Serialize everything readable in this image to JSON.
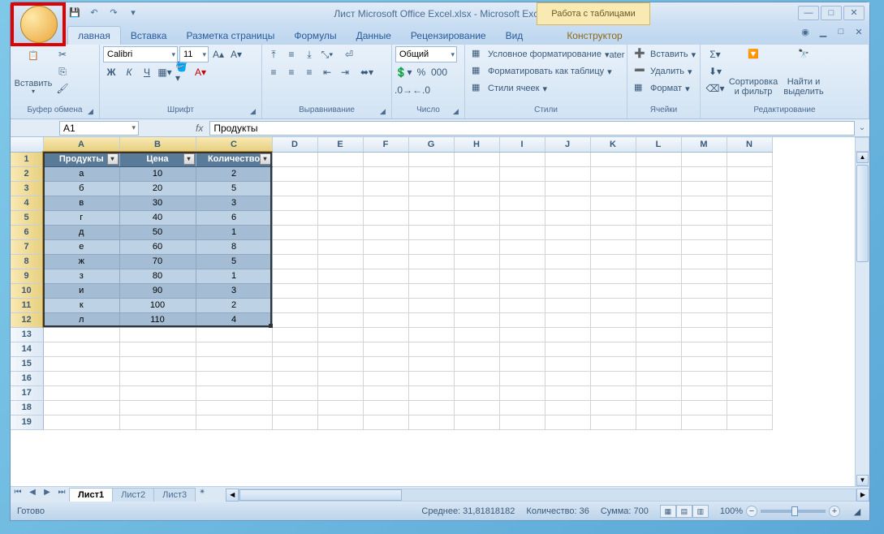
{
  "title": "Лист Microsoft Office Excel.xlsx - Microsoft Excel",
  "contextTab": "Работа с таблицами",
  "tabs": [
    "лавная",
    "Вставка",
    "Разметка страницы",
    "Формулы",
    "Данные",
    "Рецензирование",
    "Вид",
    "Конструктор"
  ],
  "ribbon": {
    "clipboard": {
      "label": "Буфер обмена",
      "paste": "Вставить"
    },
    "font": {
      "label": "Шрифт",
      "name": "Calibri",
      "size": "11"
    },
    "align": {
      "label": "Выравнивание"
    },
    "number": {
      "label": "Число",
      "format": "Общий"
    },
    "styles": {
      "label": "Стили",
      "cond": "Условное форматирование",
      "astable": "Форматировать как таблицу",
      "cellstyles": "Стили ячеек"
    },
    "cells": {
      "label": "Ячейки",
      "insert": "Вставить",
      "delete": "Удалить",
      "format": "Формат"
    },
    "editing": {
      "label": "Редактирование",
      "sort": "Сортировка\nи фильтр",
      "find": "Найти и\nвыделить"
    }
  },
  "namebox": "A1",
  "formula": "Продукты",
  "columns": [
    "A",
    "B",
    "C",
    "D",
    "E",
    "F",
    "G",
    "H",
    "I",
    "J",
    "K",
    "L",
    "M",
    "N"
  ],
  "tableHeaders": [
    "Продукты",
    "Цена",
    "Количество"
  ],
  "tableData": [
    [
      "а",
      "10",
      "2"
    ],
    [
      "б",
      "20",
      "5"
    ],
    [
      "в",
      "30",
      "3"
    ],
    [
      "г",
      "40",
      "6"
    ],
    [
      "д",
      "50",
      "1"
    ],
    [
      "е",
      "60",
      "8"
    ],
    [
      "ж",
      "70",
      "5"
    ],
    [
      "з",
      "80",
      "1"
    ],
    [
      "и",
      "90",
      "3"
    ],
    [
      "к",
      "100",
      "2"
    ],
    [
      "л",
      "110",
      "4"
    ]
  ],
  "sheets": [
    "Лист1",
    "Лист2",
    "Лист3"
  ],
  "status": {
    "ready": "Готово",
    "avg": "Среднее: 31,81818182",
    "count": "Количество: 36",
    "sum": "Сумма: 700",
    "zoom": "100%"
  }
}
